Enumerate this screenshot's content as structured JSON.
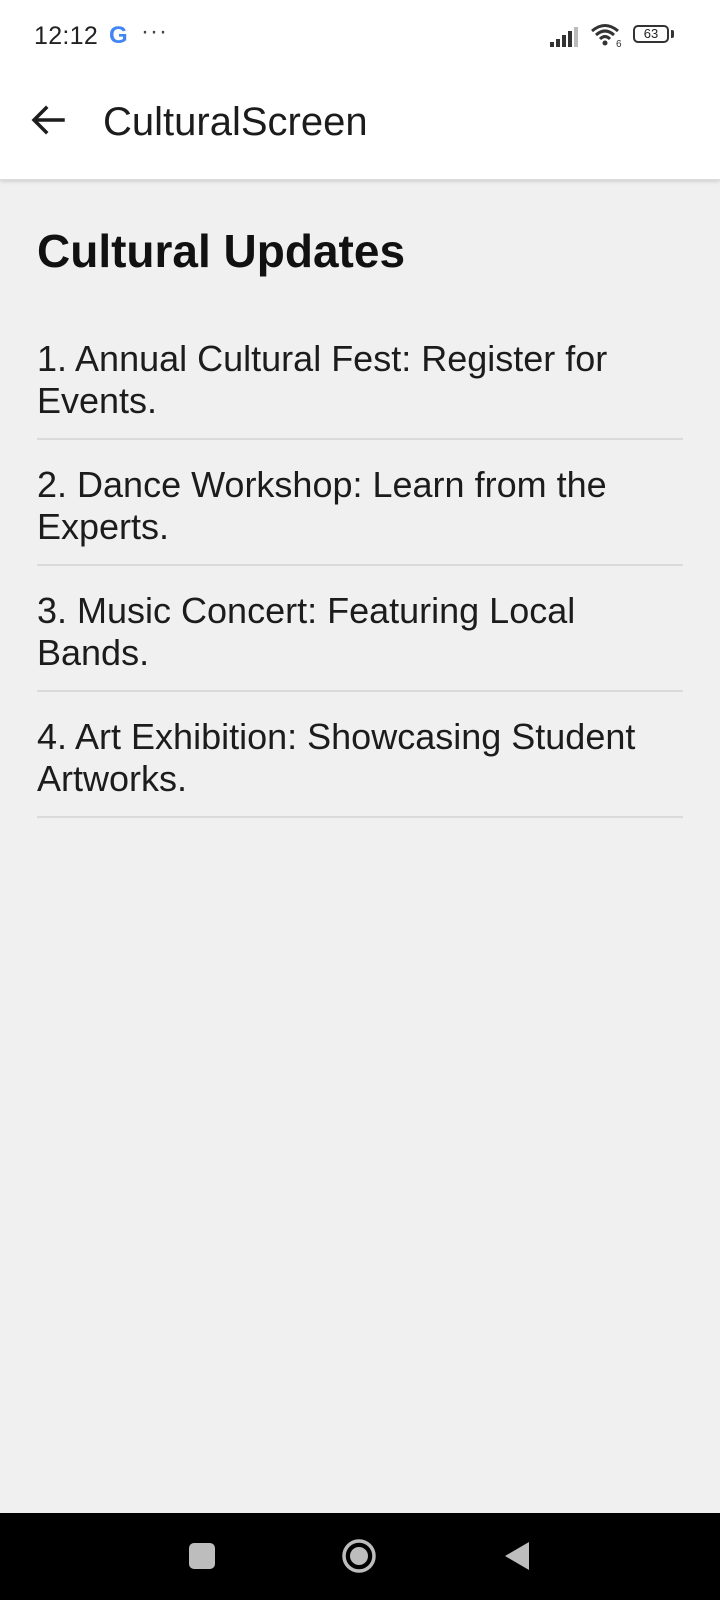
{
  "status_bar": {
    "time": "12:12",
    "google_glyph": "G",
    "overflow_dots": "···",
    "battery_level": "63",
    "icons": [
      "signal-icon",
      "wifi-icon",
      "battery-icon"
    ]
  },
  "app_bar": {
    "title": "CulturalScreen",
    "back_icon": "arrow-left-icon"
  },
  "main": {
    "heading": "Cultural Updates",
    "updates": [
      "1. Annual Cultural Fest: Register for Events.",
      "2. Dance Workshop: Learn from the Experts.",
      "3. Music Concert: Featuring Local Bands.",
      "4. Art Exhibition: Showcasing Student Artworks."
    ]
  },
  "nav_bar": {
    "icons": [
      "recents-icon",
      "home-icon",
      "back-triangle-icon"
    ]
  },
  "colors": {
    "background": "#f0f0f0",
    "app_bar": "#ffffff",
    "divider": "#dadada",
    "nav_bar": "#000000",
    "google_blue": "#4285F4",
    "google_red": "#EA4335",
    "google_yellow": "#FBBC05",
    "google_green": "#34A853"
  }
}
